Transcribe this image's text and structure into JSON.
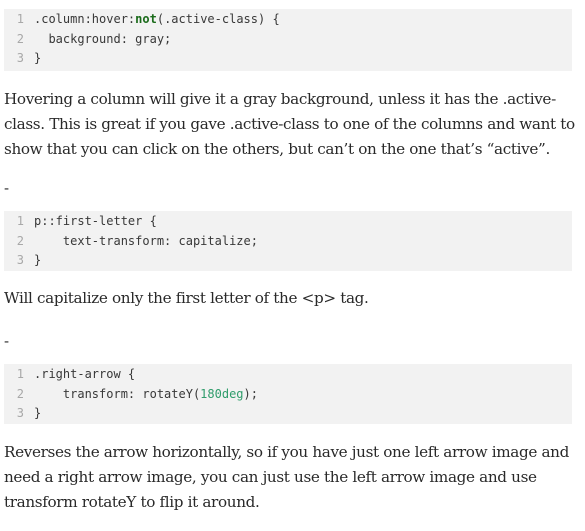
{
  "sections": [
    {
      "code": [
        {
          "n": "1",
          "parts": [
            {
              "t": ".column:hover:"
            },
            {
              "t": "not",
              "kw": true
            },
            {
              "t": "(.active-class) {"
            }
          ]
        },
        {
          "n": "2",
          "parts": [
            {
              "t": "  background: gray;"
            }
          ]
        },
        {
          "n": "3",
          "parts": [
            {
              "t": "}"
            }
          ]
        }
      ],
      "text": "Hovering a column will give it a gray background, unless it has the .active-class. This is great if you gave .active-class to one of the columns and want to show that you can click on the others, but can’t on the one that’s “active”."
    },
    {
      "code": [
        {
          "n": "1",
          "parts": [
            {
              "t": "p::first-letter {"
            }
          ]
        },
        {
          "n": "2",
          "parts": [
            {
              "t": "    text-transform: capitalize;"
            }
          ]
        },
        {
          "n": "3",
          "parts": [
            {
              "t": "}"
            }
          ]
        }
      ],
      "text": "Will capitalize only the first letter of the <p> tag."
    },
    {
      "code": [
        {
          "n": "1",
          "parts": [
            {
              "t": ".right-arrow {"
            }
          ]
        },
        {
          "n": "2",
          "parts": [
            {
              "t": "    transform: rotateY("
            },
            {
              "t": "180deg",
              "num": true
            },
            {
              "t": ");"
            }
          ]
        },
        {
          "n": "3",
          "parts": [
            {
              "t": "}"
            }
          ]
        }
      ],
      "text": "Reverses the arrow horizontally, so if you have just one left arrow image and need a right arrow image, you can just use the left arrow image and use transform rotateY to flip it around."
    }
  ],
  "separator": "-"
}
